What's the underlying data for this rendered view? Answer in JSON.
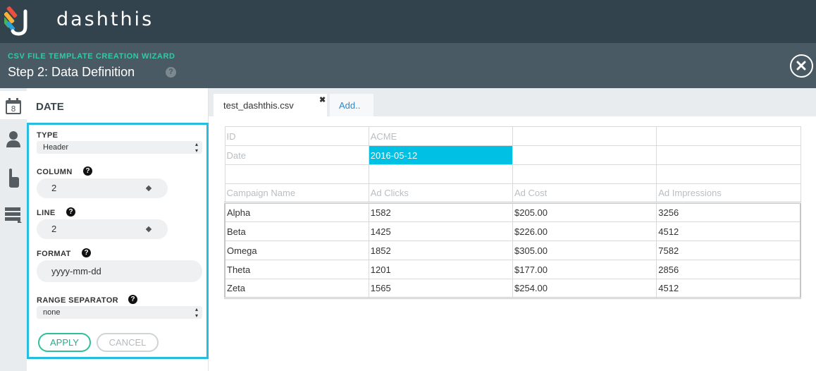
{
  "brand": {
    "name": "dashthis",
    "logo_icon": "dashthis-logo-icon"
  },
  "wizard": {
    "kicker": "CSV FILE TEMPLATE CREATION WIZARD",
    "title": "Step 2: Data Definition",
    "help": "?",
    "close_icon": "close-icon"
  },
  "rail": {
    "items": [
      {
        "icon": "calendar-icon",
        "badge": "8",
        "active": true
      },
      {
        "icon": "user-icon",
        "active": false
      },
      {
        "icon": "pointer-hand-icon",
        "active": false
      },
      {
        "icon": "table-list-icon",
        "active": false
      }
    ]
  },
  "panel": {
    "title": "DATE",
    "type": {
      "label": "TYPE",
      "value": "Header"
    },
    "column": {
      "label": "COLUMN",
      "value": "2"
    },
    "line": {
      "label": "LINE",
      "value": "2"
    },
    "format": {
      "label": "FORMAT",
      "value": "yyyy-mm-dd"
    },
    "range_separator": {
      "label": "RANGE SEPARATOR",
      "value": "none"
    },
    "help": "?",
    "apply_label": "APPLY",
    "cancel_label": "CANCEL"
  },
  "tabs": {
    "file": {
      "label": "test_dashthis.csv",
      "close": "✖"
    },
    "add": {
      "label": "Add.."
    }
  },
  "table": {
    "header_rows": [
      [
        "ID",
        "ACME",
        "",
        ""
      ],
      [
        "Date",
        "2016-05-12",
        "",
        ""
      ],
      [
        "",
        "",
        "",
        ""
      ],
      [
        "Campaign Name",
        "Ad Clicks",
        "Ad Cost",
        "Ad Impressions"
      ]
    ],
    "data_rows": [
      [
        "Alpha",
        "1582",
        "$205.00",
        "3256"
      ],
      [
        "Beta",
        "1425",
        "$226.00",
        "4512"
      ],
      [
        "Omega",
        "1852",
        "$305.00",
        "7582"
      ],
      [
        "Theta",
        "1201",
        "$177.00",
        "2856"
      ],
      [
        "Zeta",
        "1565",
        "$254.00",
        "4512"
      ]
    ],
    "highlight_color": "#00c0e4"
  },
  "colors": {
    "topbar": "#33434d",
    "wizard_header": "#4a5a64",
    "accent_teal": "#2fcaa7",
    "focus_border": "#26bde2",
    "link_blue": "#2a8ad0"
  }
}
